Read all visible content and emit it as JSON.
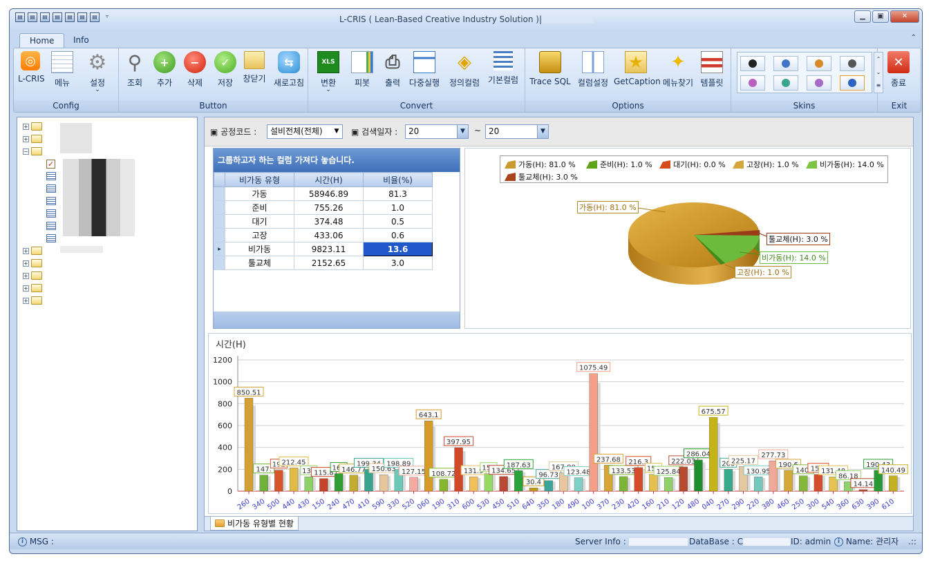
{
  "window": {
    "title": "L-CRIS ( Lean-Based Creative Industry Solution )|",
    "min": "▁",
    "max": "▣",
    "close": "✕"
  },
  "qat": [
    "▤",
    "▤",
    "▤",
    "▤",
    "▤",
    "▤",
    "▤",
    "▿"
  ],
  "tabs": {
    "home": "Home",
    "info": "Info",
    "collapse": "⌃"
  },
  "ribbon": {
    "config": {
      "title": "Config",
      "lcris": "L-CRIS",
      "menu": "메뉴",
      "settings": "설정"
    },
    "button": {
      "title": "Button",
      "query": "조회",
      "add": "추가",
      "delete": "삭제",
      "save": "저장",
      "close_window": "창닫기",
      "refresh": "새로고침"
    },
    "convert": {
      "title": "Convert",
      "convert": "변환",
      "pivot": "피봇",
      "print": "출력",
      "multi_run": "다중실행",
      "defined_columns": "정의컬럼",
      "basic_columns": "기본컬럼",
      "xls": "XLS"
    },
    "options": {
      "title": "Options",
      "trace_sql": "Trace SQL",
      "column_settings": "컬럼설정",
      "get_caption": "GetCaption",
      "find_menu": "메뉴찾기",
      "template": "템플릿"
    },
    "skins": {
      "title": "Skins"
    },
    "exit": {
      "title": "Exit",
      "exit": "종료"
    }
  },
  "filter": {
    "process_label": "▣ 공정코드 :",
    "process_value": "설비전체(전체)",
    "date_label": "▣ 검색일자 :",
    "date_from": "20",
    "date_to": "20",
    "tilde": "~"
  },
  "grid": {
    "group_hint": "그룹하고자 하는 컬럼 가져다 놓습니다.",
    "headers": [
      "비가동 유형",
      "시간(H)",
      "비율(%)"
    ],
    "rows": [
      [
        "가동",
        "58946.89",
        "81.3"
      ],
      [
        "준비",
        "755.26",
        "1.0"
      ],
      [
        "대기",
        "374.48",
        "0.5"
      ],
      [
        "고장",
        "433.06",
        "0.6"
      ],
      [
        "비가동",
        "9823.11",
        "13.6"
      ],
      [
        "툴교체",
        "2152.65",
        "3.0"
      ]
    ],
    "selected_row_marker": "▸"
  },
  "pie": {
    "legend": [
      "가동(H): 81.0 %",
      "준비(H): 1.0 %",
      "대기(H): 0.0 %",
      "고장(H): 1.0 %",
      "비가동(H): 14.0 %",
      "툴교체(H): 3.0 %"
    ],
    "legend_colors": [
      "#c99a2e",
      "#5fa31a",
      "#d64b1e",
      "#d4a63c",
      "#7cc544",
      "#a8431a"
    ],
    "labels": {
      "run": "가동(H): 81.0 %",
      "tool": "툴교체(H): 3.0 %",
      "down": "비가동(H): 14.0 %",
      "fault": "고장(H): 1.0 %"
    }
  },
  "chart_data": {
    "type": "bar",
    "title": "",
    "ylabel": "시간(H)",
    "ylim": [
      0,
      1200
    ],
    "yticks": [
      "0",
      "200",
      "400",
      "600",
      "800",
      "1000",
      "1200"
    ],
    "categories": [
      "260",
      "340",
      "500",
      "440",
      "430",
      "150",
      "240",
      "470",
      "410",
      "590",
      "330",
      "520",
      "060",
      "190",
      "310",
      "600",
      "530",
      "450",
      "510",
      "640",
      "350",
      "180",
      "490",
      "100",
      "370",
      "230",
      "420",
      "160",
      "210",
      "120",
      "480",
      "040",
      "270",
      "290",
      "220",
      "380",
      "460",
      "250",
      "300",
      "540",
      "360",
      "630",
      "390",
      "610"
    ],
    "values": [
      850.51,
      147.53,
      192.1,
      212.45,
      131.2,
      115.87,
      160.5,
      146.77,
      199.34,
      150.63,
      198.89,
      127.15,
      643.1,
      108.72,
      397.95,
      131.95,
      159.8,
      134.65,
      187.63,
      30.4,
      96.73,
      167.22,
      123.48,
      1075.49,
      237.68,
      133.53,
      216.3,
      154.2,
      125.84,
      222.03,
      286.04,
      675.57,
      200.1,
      225.17,
      130.95,
      277.73,
      190.6,
      140.2,
      153.4,
      131.48,
      86.18,
      14.14,
      190.43,
      140.49
    ],
    "value_labels": [
      "850.51",
      "147.",
      "192",
      "212.45",
      "131",
      "115.8",
      "160",
      "146.77",
      "199.34",
      "150.63",
      "198.89",
      "127.15",
      "643.1",
      "108.72",
      "397.95",
      "131.9",
      "159",
      "134.65",
      "187.63",
      "30.4",
      "96.73",
      "167.00",
      "123.48",
      "1075.49",
      "237.68",
      "133.53",
      "216.3",
      "154",
      "125.84",
      "222.03",
      "286.04",
      "675.57",
      "200",
      "225.17",
      "130.95",
      "277.73",
      "190.6",
      "140.",
      "153.",
      "131.48",
      "86.18",
      "14.14",
      "190.43",
      "140.49"
    ],
    "colors": [
      "#d4a034",
      "#6fb13a",
      "#d8542a",
      "#e1b945",
      "#8fd166",
      "#c4452a",
      "#2f9e33",
      "#c2ab2e",
      "#3aa58e",
      "#e6c79a",
      "#6bc9b8",
      "#f4a9a1",
      "#d79b2a",
      "#86b62c",
      "#d2492a",
      "#f0c05a",
      "#95d966",
      "#b94834",
      "#2aa33d",
      "#c09a18",
      "#3ca59a",
      "#e7c6a0",
      "#7fd1c6",
      "#f4a088",
      "#d8a534",
      "#7fb43a",
      "#d44c2a",
      "#e3c050",
      "#8fd068",
      "#b84a30",
      "#1f8f2d",
      "#c4b418",
      "#3aa88a",
      "#e4c9a0",
      "#74c9bc",
      "#f0a898",
      "#d6a838",
      "#84b83a",
      "#d44e2c",
      "#e6c252",
      "#8fd46a",
      "#b84a32",
      "#269a35",
      "#c4b020"
    ]
  },
  "bottom_tab": "비가동 유형별 현황",
  "status": {
    "msg": "MSG :",
    "server": "Server Info :",
    "database": "DataBase :",
    "db_partial": "C",
    "id": "ID: admin",
    "name": "Name: 관리자",
    "grip": ".::"
  }
}
